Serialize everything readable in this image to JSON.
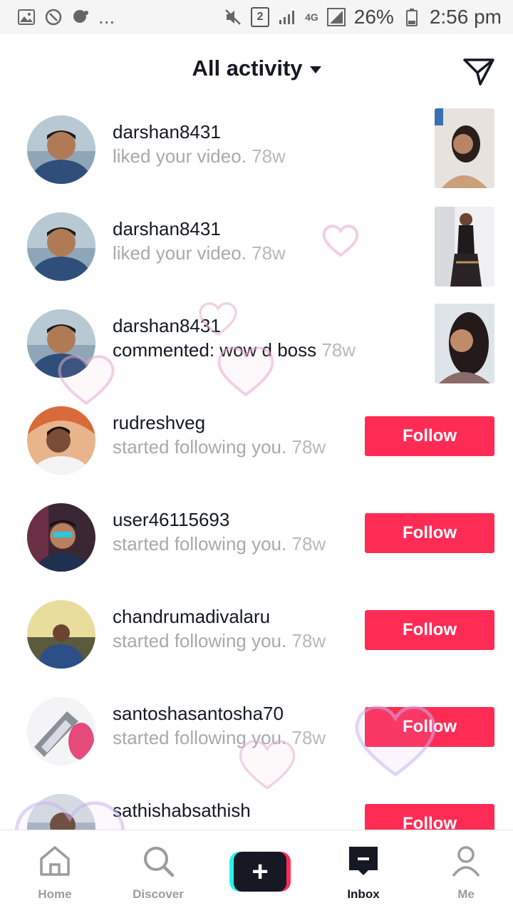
{
  "status_bar": {
    "left_icons": [
      "image-icon",
      "sync-icon",
      "chat-icon"
    ],
    "ellipsis": "...",
    "sim_badge": "2",
    "network": "4G",
    "battery": "26%",
    "time": "2:56 pm"
  },
  "header": {
    "title": "All activity"
  },
  "activities": [
    {
      "username": "darshan8431",
      "action": "liked your video.",
      "time": "78w",
      "type": "video"
    },
    {
      "username": "darshan8431",
      "action": "liked your video.",
      "time": "78w",
      "type": "video"
    },
    {
      "username": "darshan8431",
      "action": "commented: wow d boss",
      "time": "78w",
      "type": "video"
    },
    {
      "username": "rudreshveg",
      "action": "started following you.",
      "time": "78w",
      "type": "follow",
      "button": "Follow"
    },
    {
      "username": "user46115693",
      "action": "started following you.",
      "time": "78w",
      "type": "follow",
      "button": "Follow"
    },
    {
      "username": "chandrumadivalaru",
      "action": "started following you.",
      "time": "78w",
      "type": "follow",
      "button": "Follow"
    },
    {
      "username": "santoshasantosha70",
      "action": "started following you.",
      "time": "78w",
      "type": "follow",
      "button": "Follow"
    },
    {
      "username": "sathishabsathish",
      "action": "",
      "time": "",
      "type": "follow",
      "button": "Follow"
    }
  ],
  "bottom_nav": {
    "home": "Home",
    "discover": "Discover",
    "inbox": "Inbox",
    "me": "Me",
    "active": "inbox"
  },
  "colors": {
    "accent": "#fe2c55",
    "text": "#161823",
    "muted": "#a7a9ad"
  }
}
